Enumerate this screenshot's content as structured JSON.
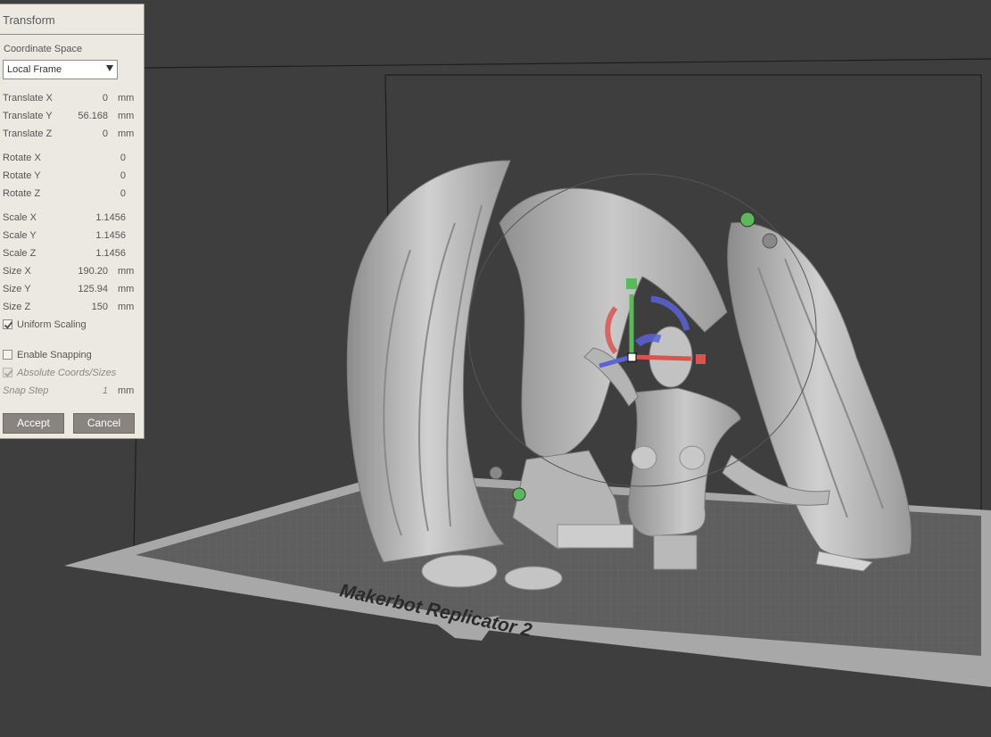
{
  "panel": {
    "title": "Transform",
    "coordinate_space_label": "Coordinate Space",
    "coordinate_space_value": "Local Frame",
    "translate": [
      {
        "label": "Translate X",
        "value": "0",
        "unit": "mm"
      },
      {
        "label": "Translate Y",
        "value": "56.168",
        "unit": "mm"
      },
      {
        "label": "Translate Z",
        "value": "0",
        "unit": "mm"
      }
    ],
    "rotate": [
      {
        "label": "Rotate X",
        "value": "0"
      },
      {
        "label": "Rotate Y",
        "value": "0"
      },
      {
        "label": "Rotate Z",
        "value": "0"
      }
    ],
    "scale": [
      {
        "label": "Scale X",
        "value": "1.1456"
      },
      {
        "label": "Scale Y",
        "value": "1.1456"
      },
      {
        "label": "Scale Z",
        "value": "1.1456"
      }
    ],
    "size": [
      {
        "label": "Size X",
        "value": "190.20",
        "unit": "mm"
      },
      {
        "label": "Size Y",
        "value": "125.94",
        "unit": "mm"
      },
      {
        "label": "Size Z",
        "value": "150",
        "unit": "mm"
      }
    ],
    "uniform_scaling": {
      "label": "Uniform Scaling",
      "checked": true
    },
    "enable_snapping": {
      "label": "Enable Snapping",
      "checked": false
    },
    "absolute_coords": {
      "label": "Absolute Coords/Sizes",
      "checked": true
    },
    "snap_step": {
      "label": "Snap Step",
      "value": "1",
      "unit": "mm"
    },
    "accept_label": "Accept",
    "cancel_label": "Cancel"
  },
  "scene": {
    "printer_label": "Makerbot Replicator 2",
    "colors": {
      "background": "#3e3e3e",
      "model": "#b9b9b9",
      "bed": "#a9a9a9",
      "gizmo_x": "#d9534f",
      "gizmo_y": "#5cb85c",
      "gizmo_z": "#5b63d6"
    }
  }
}
